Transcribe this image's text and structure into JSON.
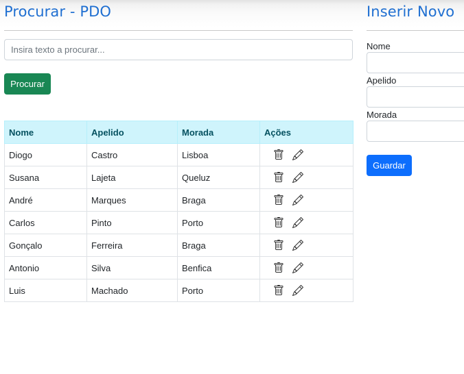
{
  "search_panel": {
    "title": "Procurar - PDO",
    "search_placeholder": "Insira texto a procurar...",
    "search_button_label": "Procurar",
    "table": {
      "columns": [
        "Nome",
        "Apelido",
        "Morada",
        "Ações"
      ],
      "rows": [
        {
          "nome": "Diogo",
          "apelido": "Castro",
          "morada": "Lisboa"
        },
        {
          "nome": "Susana",
          "apelido": "Lajeta",
          "morada": "Queluz"
        },
        {
          "nome": "André",
          "apelido": "Marques",
          "morada": "Braga"
        },
        {
          "nome": "Carlos",
          "apelido": "Pinto",
          "morada": "Porto"
        },
        {
          "nome": "Gonçalo",
          "apelido": "Ferreira",
          "morada": "Braga"
        },
        {
          "nome": "Antonio",
          "apelido": "Silva",
          "morada": "Benfica"
        },
        {
          "nome": "Luis",
          "apelido": "Machado",
          "morada": "Porto"
        }
      ],
      "row_actions": {
        "delete_icon": "trash-icon",
        "edit_icon": "pencil-icon"
      }
    }
  },
  "insert_panel": {
    "title": "Inserir Novo",
    "fields": [
      {
        "label": "Nome",
        "value": ""
      },
      {
        "label": "Apelido",
        "value": ""
      },
      {
        "label": "Morada",
        "value": ""
      }
    ],
    "save_button_label": "Guardar"
  },
  "colors": {
    "title": "#1f6fd1",
    "search_button": "#198754",
    "save_button": "#0d6efd",
    "table_header_bg": "#cff4fc",
    "table_header_text": "#055160"
  }
}
